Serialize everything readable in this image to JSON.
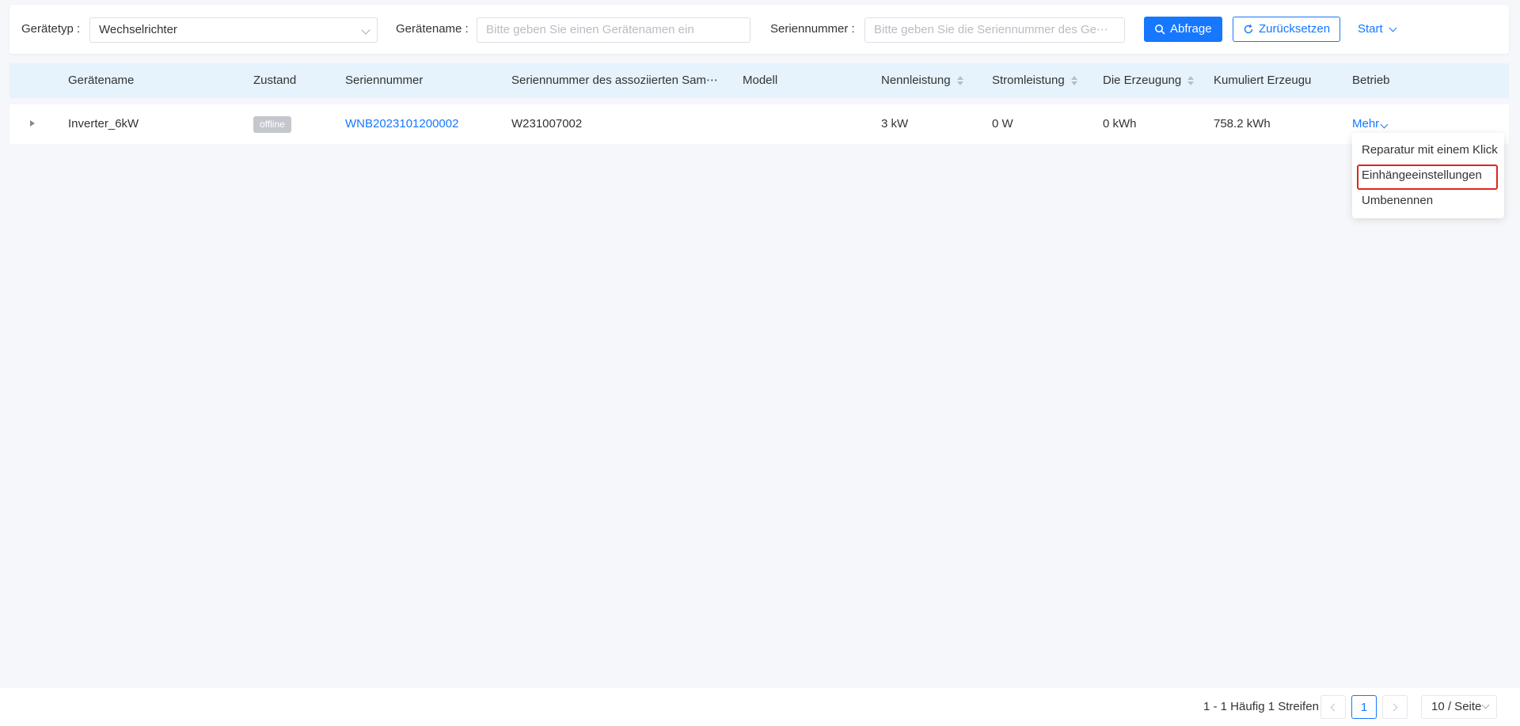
{
  "filters": {
    "device_type_label": "Gerätetyp :",
    "device_type_value": "Wechselrichter",
    "device_name_label": "Gerätename :",
    "device_name_placeholder": "Bitte geben Sie einen Gerätenamen ein",
    "serial_label": "Seriennummer :",
    "serial_placeholder": "Bitte geben Sie die Seriennummer des Ge⋯",
    "query_button": "Abfrage",
    "reset_button": "Zurücksetzen",
    "start_link": "Start"
  },
  "table": {
    "columns": {
      "name": "Gerätename",
      "state": "Zustand",
      "serial": "Seriennummer",
      "assoc_serial": "Seriennummer des assoziierten Sam⋯",
      "model": "Modell",
      "rated_power": "Nennleistung",
      "current_power": "Stromleistung",
      "generation": "Die Erzeugung",
      "cumulative": "Kumuliert Erzeugu",
      "operation": "Betrieb"
    },
    "rows": [
      {
        "name": "Inverter_6kW",
        "state": "offline",
        "serial": "WNB2023101200002",
        "assoc_serial": "W231007002",
        "model": "",
        "rated_power": "3 kW",
        "current_power": "0 W",
        "generation": "0 kWh",
        "cumulative": "758.2 kWh",
        "operation": "Mehr"
      }
    ]
  },
  "dropdown": {
    "items": [
      "Reparatur mit einem Klick",
      "Einhängeeinstellungen",
      "Umbenennen"
    ],
    "highlighted_index": 1
  },
  "pagination": {
    "summary": "1 - 1 Häufig 1 Streifen",
    "current_page": "1",
    "page_size": "10 / Seite"
  },
  "colors": {
    "primary": "#1677ff",
    "header_bg": "#e6f3fc",
    "badge_offline": "#c4c7cc",
    "highlight_border": "#e0261d"
  }
}
